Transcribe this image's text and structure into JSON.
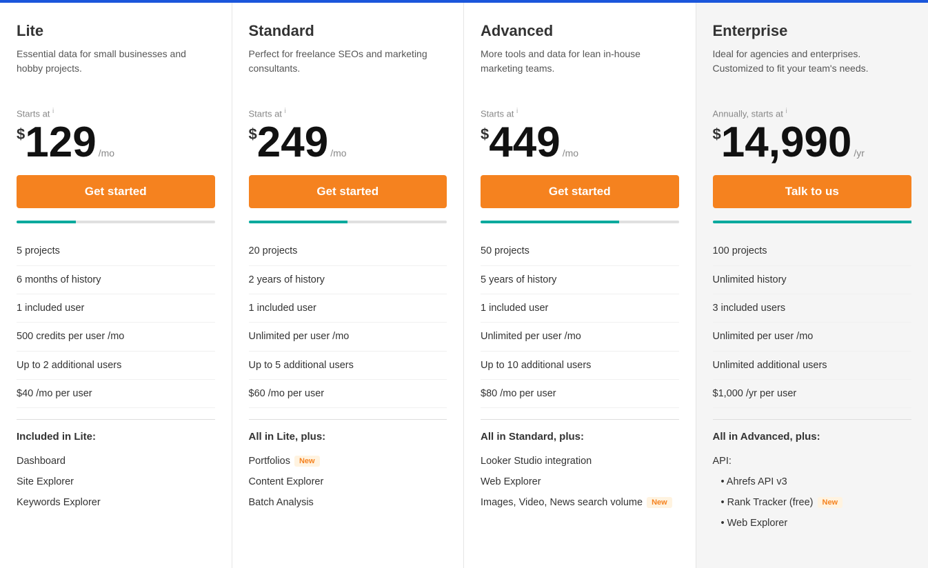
{
  "plans": [
    {
      "id": "lite",
      "name": "Lite",
      "desc": "Essential data for small businesses and hobby projects.",
      "price_label": "Starts at",
      "price_superscript": "i",
      "dollar": "$",
      "amount": "129",
      "period": "/mo",
      "cta": "Get started",
      "progress_fill": "30%",
      "features": [
        "5 projects",
        "6 months of history",
        "1 included user",
        "500 credits per user /mo",
        "Up to 2 additional users",
        "$40 /mo per user"
      ],
      "included_title": "Included in Lite:",
      "included": [
        {
          "text": "Dashboard",
          "badge": null
        },
        {
          "text": "Site Explorer",
          "badge": null
        },
        {
          "text": "Keywords Explorer",
          "badge": null
        }
      ],
      "bg": "#fff"
    },
    {
      "id": "standard",
      "name": "Standard",
      "desc": "Perfect for freelance SEOs and marketing consultants.",
      "price_label": "Starts at",
      "price_superscript": "i",
      "dollar": "$",
      "amount": "249",
      "period": "/mo",
      "cta": "Get started",
      "progress_fill": "50%",
      "features": [
        "20 projects",
        "2 years of history",
        "1 included user",
        "Unlimited per user /mo",
        "Up to 5 additional users",
        "$60 /mo per user"
      ],
      "included_title": "All in Lite, plus:",
      "included": [
        {
          "text": "Portfolios",
          "badge": "New"
        },
        {
          "text": "Content Explorer",
          "badge": null
        },
        {
          "text": "Batch Analysis",
          "badge": null
        }
      ],
      "bg": "#fff"
    },
    {
      "id": "advanced",
      "name": "Advanced",
      "desc": "More tools and data for lean in-house marketing teams.",
      "price_label": "Starts at",
      "price_superscript": "i",
      "dollar": "$",
      "amount": "449",
      "period": "/mo",
      "cta": "Get started",
      "progress_fill": "70%",
      "features": [
        "50 projects",
        "5 years of history",
        "1 included user",
        "Unlimited per user /mo",
        "Up to 10 additional users",
        "$80 /mo per user"
      ],
      "included_title": "All in Standard, plus:",
      "included": [
        {
          "text": "Looker Studio integration",
          "badge": null
        },
        {
          "text": "Web Explorer",
          "badge": null
        },
        {
          "text": "Images, Video, News search volume",
          "badge": "New"
        }
      ],
      "bg": "#fff"
    },
    {
      "id": "enterprise",
      "name": "Enterprise",
      "desc": "Ideal for agencies and enterprises. Customized to fit your team's needs.",
      "price_label": "Annually, starts at",
      "price_superscript": "i",
      "dollar": "$",
      "amount": "14,990",
      "period": "/yr",
      "cta": "Talk to us",
      "progress_fill": "100%",
      "features": [
        "100 projects",
        "Unlimited history",
        "3 included users",
        "Unlimited per user /mo",
        "Unlimited additional users",
        "$1,000 /yr per user"
      ],
      "included_title": "All in Advanced, plus:",
      "included": [
        {
          "text": "API:",
          "badge": null
        },
        {
          "text": "Ahrefs API v3",
          "bullet": true,
          "badge": null
        },
        {
          "text": "Rank Tracker (free)",
          "bullet": true,
          "badge": "New"
        },
        {
          "text": "Web Explorer",
          "bullet": true,
          "badge": null
        }
      ],
      "bg": "#f5f5f5"
    }
  ]
}
